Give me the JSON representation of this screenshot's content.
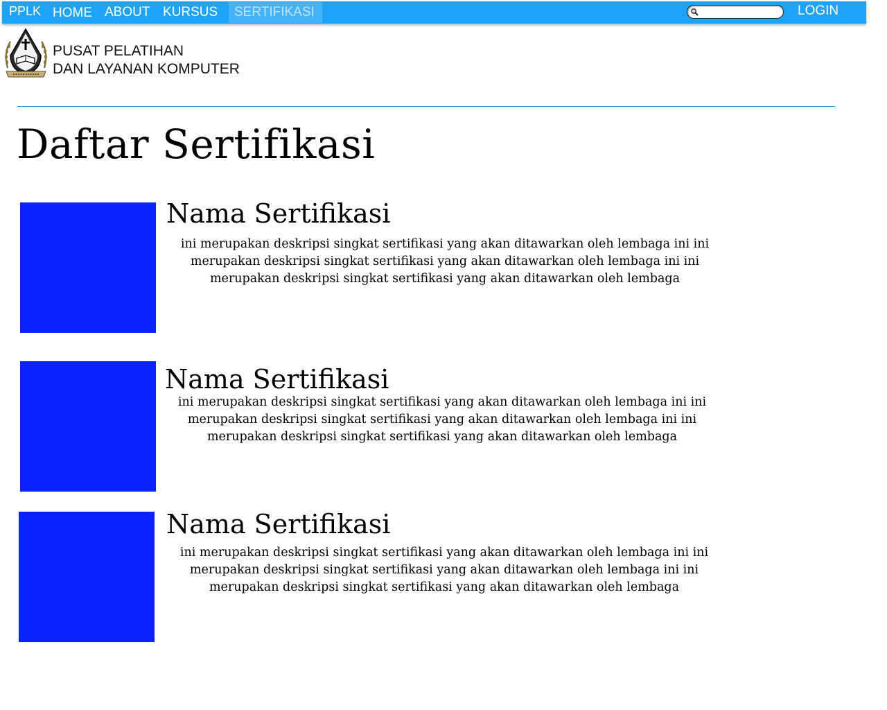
{
  "nav": {
    "brand": "PPLK",
    "items": [
      {
        "label": "HOME"
      },
      {
        "label": "ABOUT"
      },
      {
        "label": "KURSUS"
      },
      {
        "label": "SERTIFIKASI"
      }
    ],
    "login_label": "LOGIN",
    "search_value": "",
    "bar_color": "#1da3f8",
    "active_item": "SERTIFIKASI"
  },
  "header": {
    "org_line1": "PUSAT PELATIHAN",
    "org_line2": "DAN LAYANAN KOMPUTER"
  },
  "main": {
    "title": "Daftar Sertifikasi",
    "certifications": [
      {
        "name": "Nama Sertifikasi",
        "description": "ini merupakan deskripsi singkat sertifikasi yang akan ditawarkan oleh lembaga ini ini merupakan deskripsi singkat sertifikasi yang akan ditawarkan oleh lembaga ini ini merupakan deskripsi singkat sertifikasi yang akan ditawarkan oleh lembaga",
        "thumb_color": "#0a22ff"
      },
      {
        "name": "Nama Sertifikasi",
        "description": "ini merupakan deskripsi singkat sertifikasi yang akan ditawarkan oleh lembaga ini ini merupakan deskripsi singkat sertifikasi yang akan ditawarkan oleh lembaga ini ini merupakan deskripsi singkat sertifikasi yang akan ditawarkan oleh lembaga",
        "thumb_color": "#0a22ff"
      },
      {
        "name": "Nama Sertifikasi",
        "description": "ini merupakan deskripsi singkat sertifikasi yang akan ditawarkan oleh lembaga ini ini merupakan deskripsi singkat sertifikasi yang akan ditawarkan oleh lembaga ini ini merupakan deskripsi singkat sertifikasi yang akan ditawarkan oleh lembaga",
        "thumb_color": "#0a22ff"
      }
    ]
  }
}
